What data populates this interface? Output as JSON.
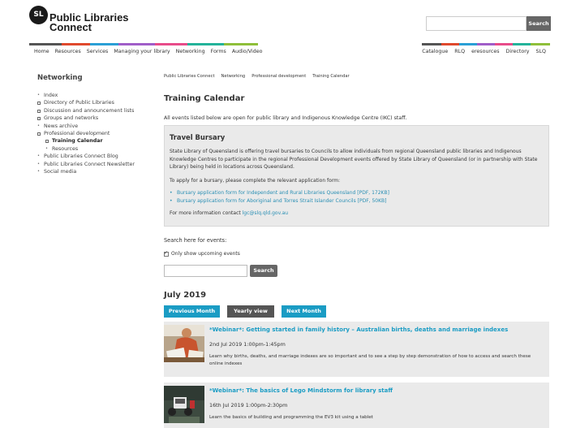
{
  "logo": {
    "badge": "SL",
    "line1": "Public Libraries",
    "line2": "Connect"
  },
  "top_search": {
    "placeholder": "",
    "button": "Search"
  },
  "nav_left": [
    "Home",
    "Resources",
    "Services",
    "Managing your library",
    "Networking",
    "Forms",
    "Audio/Video"
  ],
  "nav_right": [
    "Catalogue",
    "RLQ",
    "eresources",
    "Directory",
    "SLQ"
  ],
  "stripe_colors": [
    "#555555",
    "#e0492d",
    "#2a9fd6",
    "#a05ec8",
    "#e84c8a",
    "#23b39a",
    "#8fbf3a"
  ],
  "sidebar": {
    "title": "Networking",
    "items": [
      {
        "label": "Index",
        "marker": "bullet"
      },
      {
        "label": "Directory of Public Libraries",
        "marker": "box"
      },
      {
        "label": "Discussion and announcement lists",
        "marker": "box"
      },
      {
        "label": "Groups and networks",
        "marker": "box"
      },
      {
        "label": "News archive",
        "marker": "bullet"
      },
      {
        "label": "Professional development",
        "marker": "box"
      },
      {
        "label": "Training Calendar",
        "marker": "box",
        "sub": true,
        "active": true
      },
      {
        "label": "Resources",
        "marker": "bullet",
        "sub": true
      },
      {
        "label": "Public Libraries Connect Blog",
        "marker": "bullet"
      },
      {
        "label": "Public Libraries Connect Newsletter",
        "marker": "bullet"
      },
      {
        "label": "Social media",
        "marker": "bullet"
      }
    ]
  },
  "breadcrumb": [
    "Public Libraries Connect",
    "Networking",
    "Professional development",
    "Training Calendar"
  ],
  "page_title": "Training Calendar",
  "intro": "All events listed below are open for public library and Indigenous Knowledge Centre (IKC) staff.",
  "bursary": {
    "heading": "Travel Bursary",
    "para1": "State Library of Queensland is offering travel bursaries to Councils to allow individuals from regional Queensland public libraries and Indigenous Knowledge Centres to participate in the regional Professional Development events offered by State Library of Queensland (or in partnership with State Library) being held in locations across Queensland.",
    "para2": "To apply for a bursary, please complete the relevant application form:",
    "links": [
      "Bursary application form for Independent and Rural Libraries Queensland [PDF, 172KB]",
      "Bursary application form for Aboriginal and Torres Strait Islander Councils [PDF, 50KB]"
    ],
    "contact_prefix": "For more information contact ",
    "contact_email": "lgc@slq.qld.gov.au"
  },
  "event_search": {
    "label": "Search here for events:",
    "checkbox_label": "Only show upcoming events",
    "checkbox_checked": true,
    "input_placeholder": "",
    "button": "Search"
  },
  "month_label": "July 2019",
  "month_nav": {
    "prev": "Previous Month",
    "year": "Yearly view",
    "next": "Next Month"
  },
  "events": [
    {
      "title": "*Webinar*: Getting started in family history – Australian births, deaths and marriage indexes",
      "date": "2nd Jul 2019 1:00pm-1:45pm",
      "description": "Learn why births, deaths, and marriage indexes are so important and to see a step by step demonstration of how to access and search these online indexes"
    },
    {
      "title": "*Webinar*: The basics of Lego Mindstorm for library staff",
      "date": "16th Jul 2019 1:00pm-2:30pm",
      "description": "Learn the basics of building and programming the EV3 kit using a tablet"
    }
  ]
}
